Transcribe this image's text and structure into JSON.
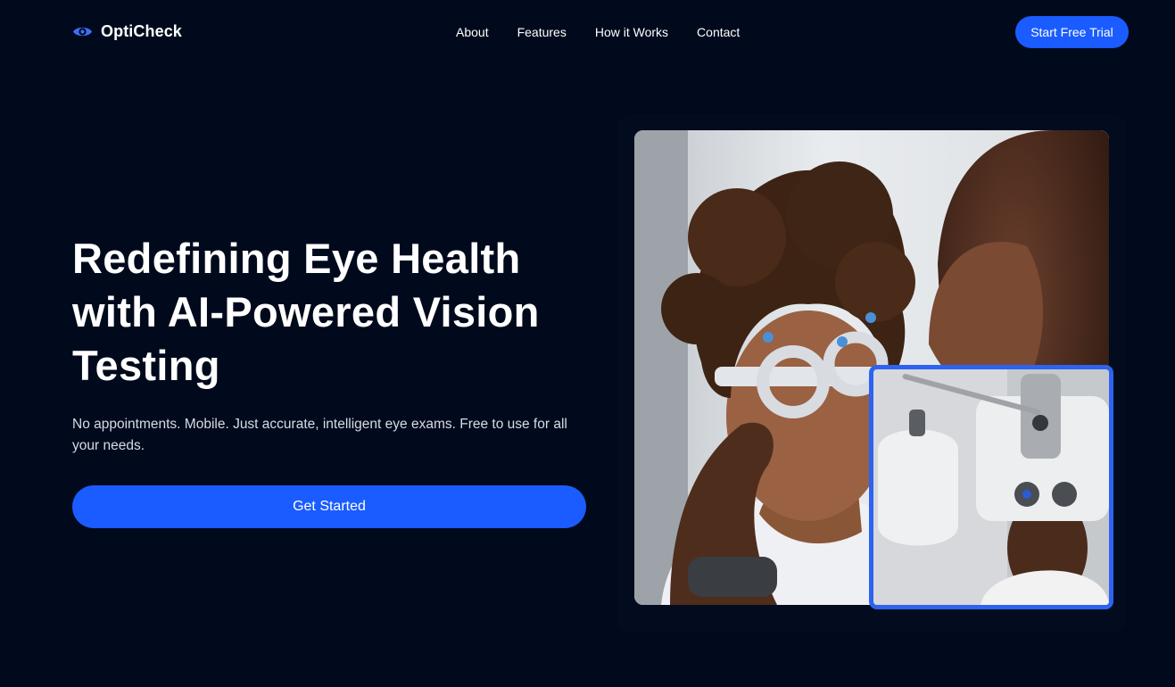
{
  "brand": {
    "name": "OptiCheck",
    "icon": "eye-icon",
    "accent": "#1a5cff"
  },
  "nav": {
    "links": [
      "About",
      "Features",
      "How it Works",
      "Contact"
    ],
    "cta_label": "Start Free Trial"
  },
  "hero": {
    "title": "Redefining Eye Health with AI-Powered Vision Testing",
    "subtitle": "No appointments. Mobile. Just accurate, intelligent eye exams. Free to use for all your needs.",
    "cta_label": "Get Started"
  },
  "colors": {
    "background": "#010a1c",
    "button": "#1a5cff",
    "inset_border": "#2d63f0"
  }
}
